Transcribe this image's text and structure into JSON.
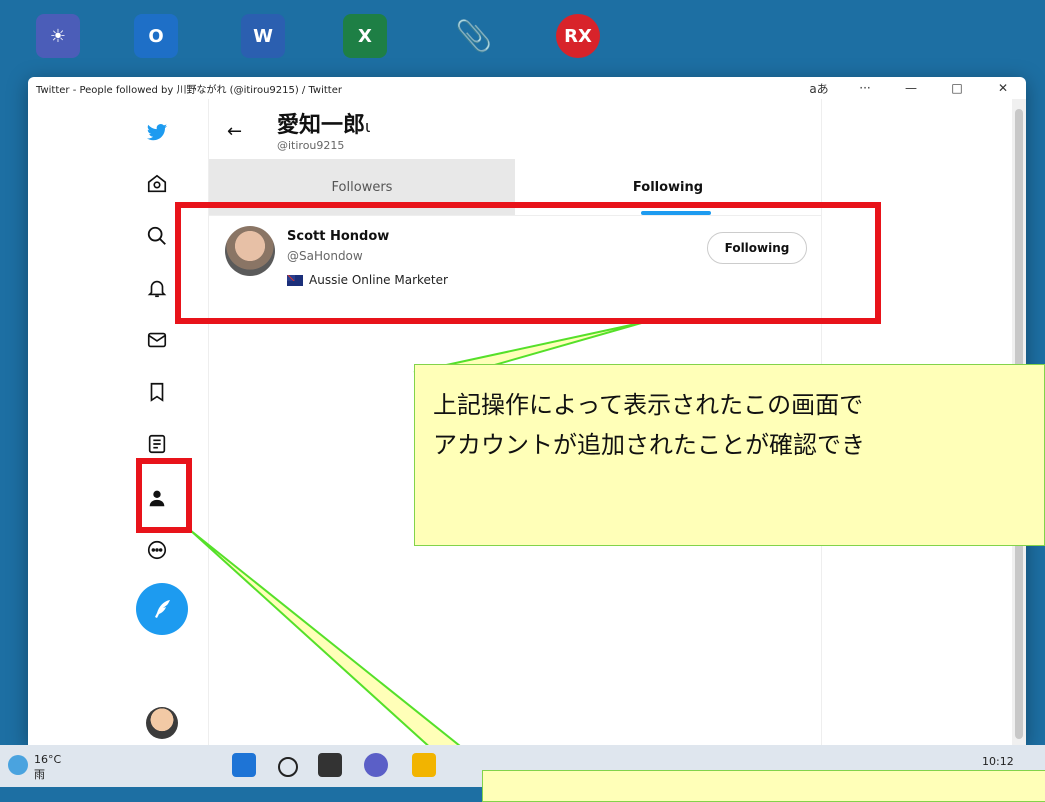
{
  "window": {
    "title": "Twitter - People followed by 川野ながれ (@itirou9215) / Twitter",
    "controls": [
      "aあ",
      "···",
      "—",
      "□",
      "✕"
    ]
  },
  "profile": {
    "name": "愛知一郎",
    "name_suffix": "ι",
    "handle": "@itirou9215"
  },
  "tabs": [
    {
      "label": "Followers",
      "selected": false
    },
    {
      "label": "Following",
      "selected": true
    }
  ],
  "following_list": [
    {
      "name": "Scott Hondow",
      "handle": "@SaHondow",
      "bio": "Aussie Online Marketer",
      "button": "Following"
    }
  ],
  "callout": {
    "line1": "上記操作によって表示されたこの画面で",
    "line2": "アカウントが追加されたことが確認でき"
  },
  "taskbar": {
    "temperature": "16°C",
    "condition": "雨",
    "time": "10:12"
  },
  "colors": {
    "twitter_blue": "#1d9bf0",
    "highlight_red": "#e8131a",
    "callout_bg": "#ffffb8",
    "callout_border": "#82d34a"
  },
  "icons": [
    "twitter-bird-icon",
    "home-icon",
    "search-icon",
    "bell-icon",
    "mail-icon",
    "bookmark-icon",
    "lists-icon",
    "profile-icon",
    "more-icon",
    "tweet-compose-icon"
  ]
}
